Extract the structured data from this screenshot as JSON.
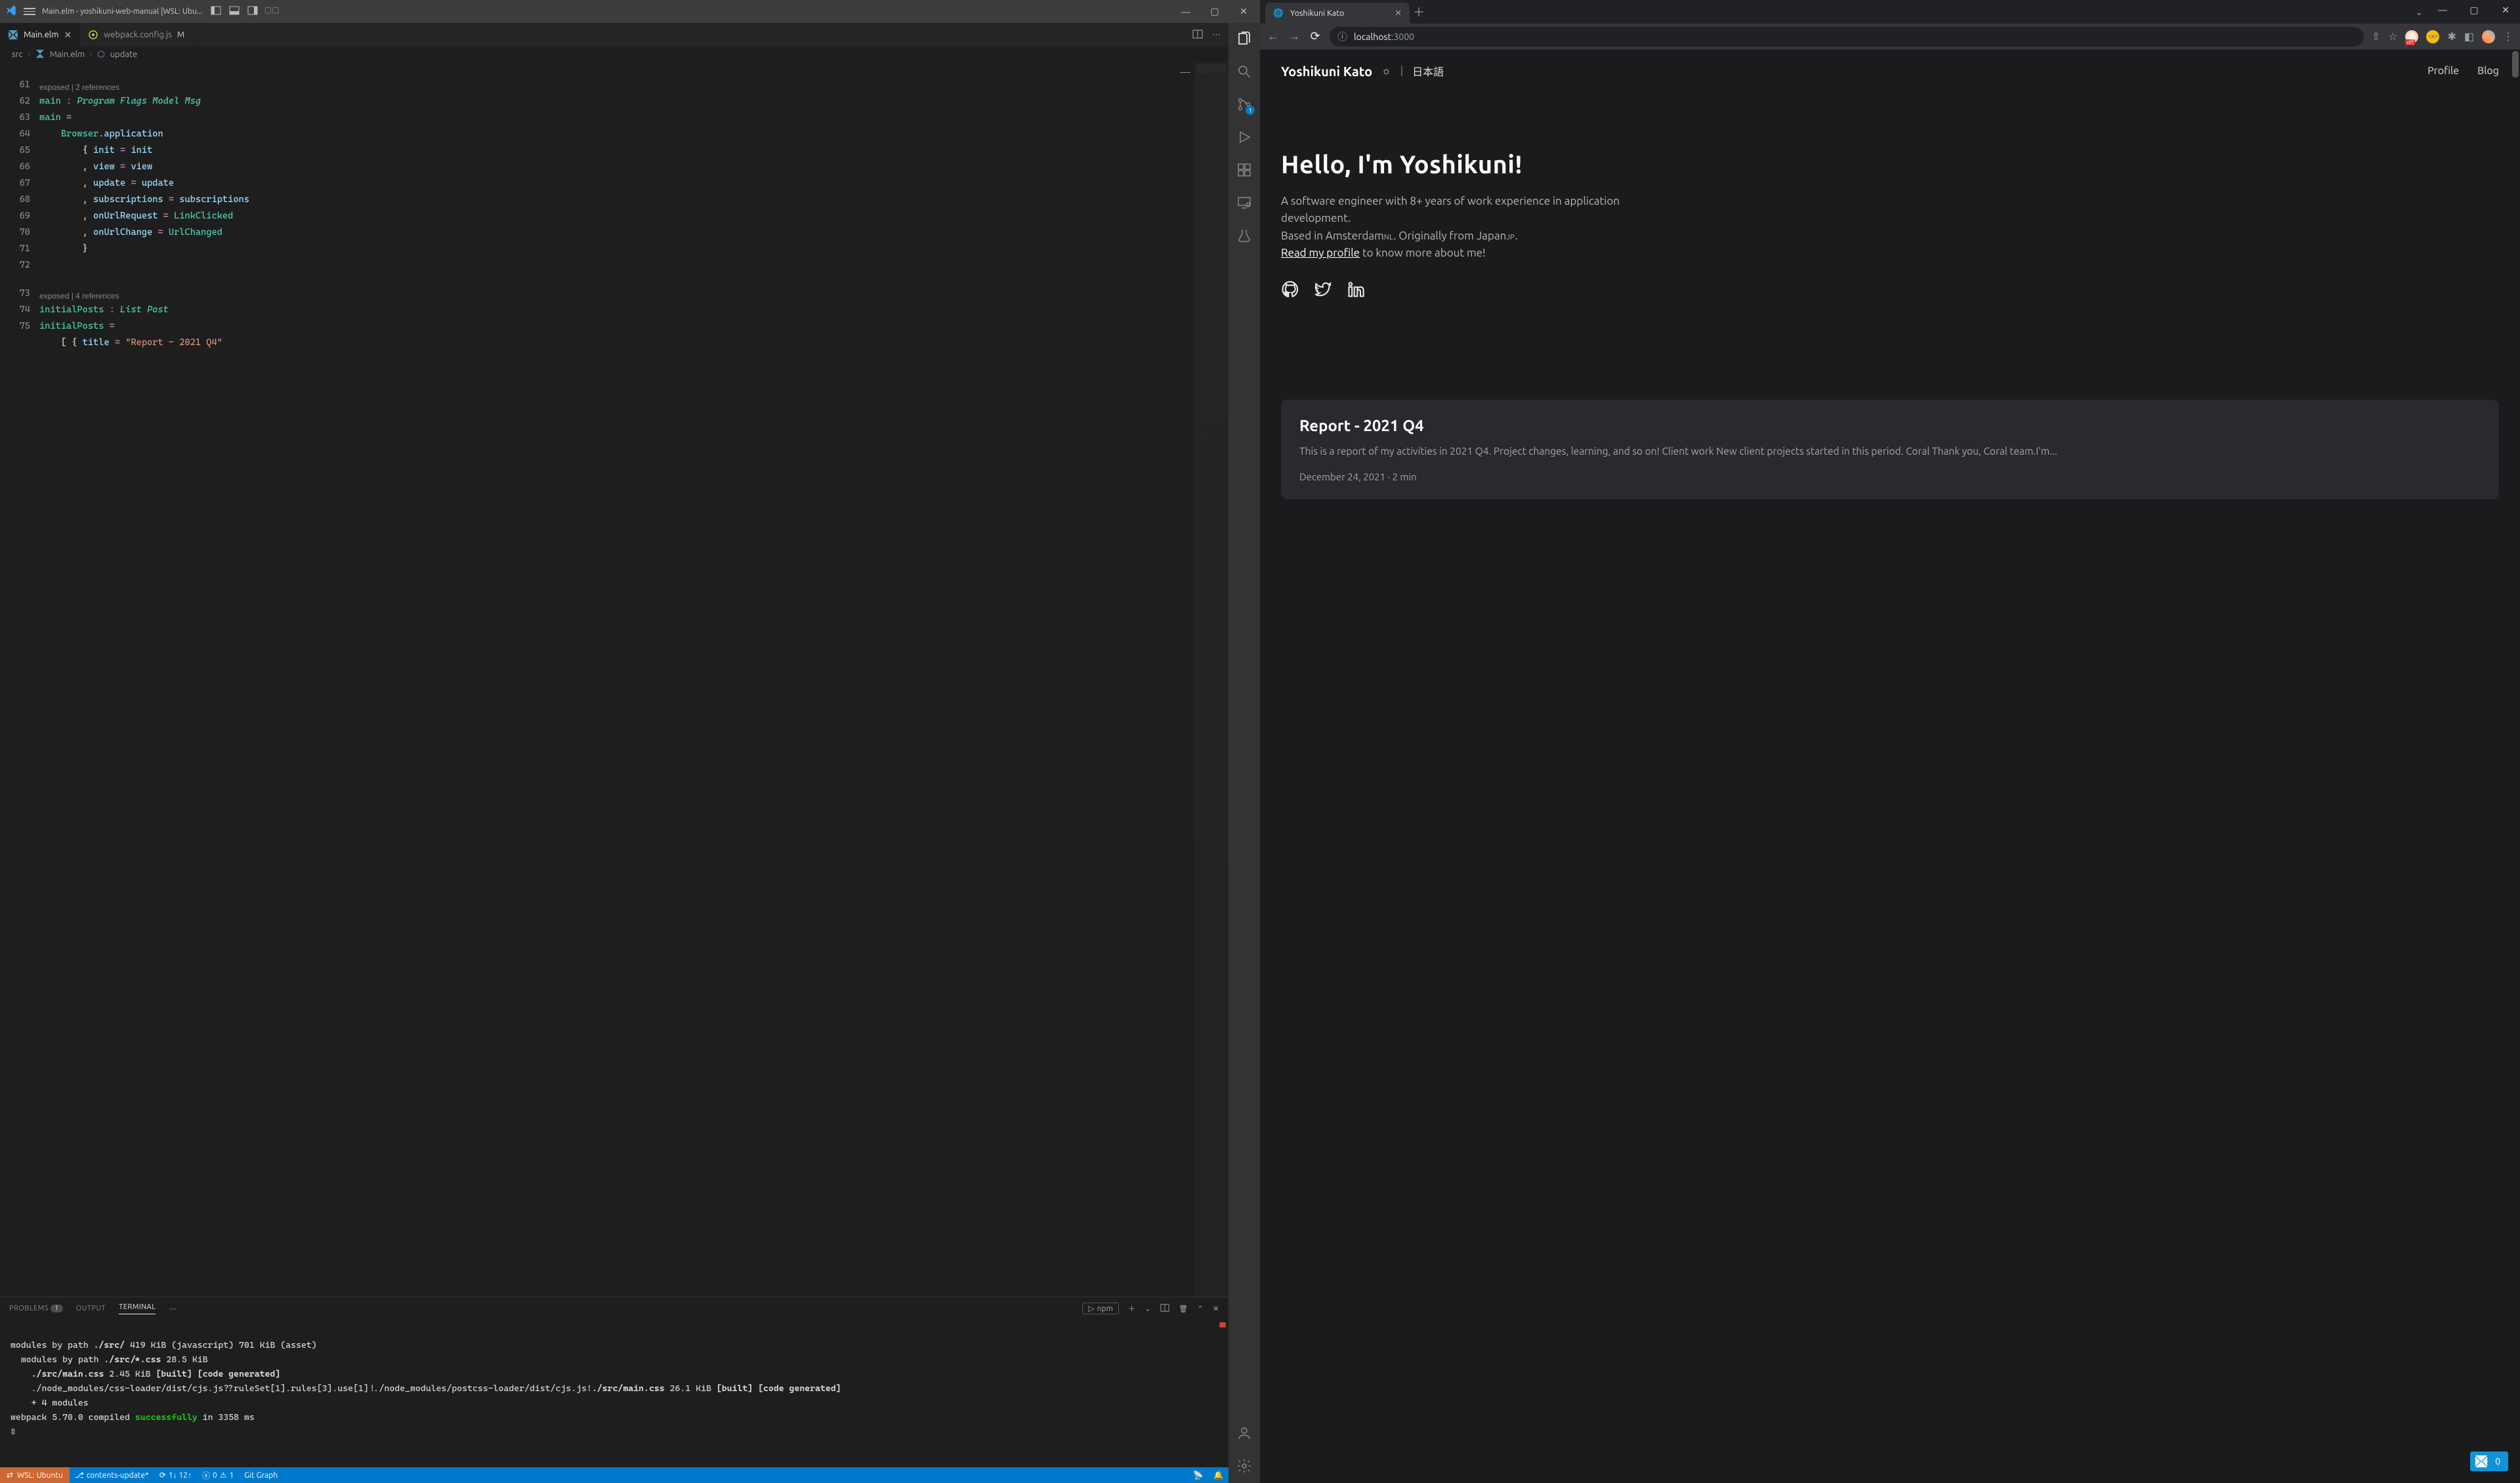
{
  "vscode": {
    "titlebar": {
      "title": "Main.elm - yoshikuni-web-manual [WSL: Ubu..."
    },
    "activitybar": {
      "scm_badge": "1"
    },
    "tabs": [
      {
        "label": "Main.elm",
        "icon_color": "#519aba",
        "active": true,
        "dirty": false
      },
      {
        "label": "webpack.config.js",
        "icon_color": "#cbcb41",
        "active": false,
        "dirty": true,
        "suffix": "M"
      }
    ],
    "breadcrumb": {
      "p1": "src",
      "p2": "Main.elm",
      "p3": "update"
    },
    "codelens1": "exposed | 2 references",
    "codelens2": "exposed | 4 references",
    "lines": {
      "n61": "61",
      "n62": "62",
      "n63": "63",
      "n64": "64",
      "n65": "65",
      "n66": "66",
      "n67": "67",
      "n68": "68",
      "n69": "69",
      "n70": "70",
      "n71": "71",
      "n72": "72",
      "n73": "73",
      "n74": "74",
      "n75": "75"
    },
    "code": {
      "l61_main": "main",
      "l61_colon": " : ",
      "l61_Program": "Program",
      "l61_sp": " ",
      "l61_Flags": "Flags",
      "l61_Model": "Model",
      "l61_Msg": "Msg",
      "l62_main": "main",
      "l62_eq": " =",
      "l63_Browser": "Browser",
      "l63_dot": ".",
      "l63_app": "application",
      "l64_brace": "{ ",
      "l64_k": "init",
      "l64_eq": " = ",
      "l64_v": "init",
      "l65_comma": ", ",
      "l65_k": "view",
      "l65_eq": " = ",
      "l65_v": "view",
      "l66_comma": ", ",
      "l66_k": "update",
      "l66_eq": " = ",
      "l66_v": "update",
      "l67_comma": ", ",
      "l67_k": "subscriptions",
      "l67_eq": " = ",
      "l67_v": "subscriptions",
      "l68_comma": ", ",
      "l68_k": "onUrlRequest",
      "l68_eq": " = ",
      "l68_v": "LinkClicked",
      "l69_comma": ", ",
      "l69_k": "onUrlChange",
      "l69_eq": " = ",
      "l69_v": "UrlChanged",
      "l70_brace": "}",
      "l73_name": "initialPosts",
      "l73_colon": " : ",
      "l73_List": "List",
      "l73_sp": " ",
      "l73_Post": "Post",
      "l74_name": "initialPosts",
      "l74_eq": " =",
      "l75_open": "[ { ",
      "l75_k": "title",
      "l75_eq": " = ",
      "l75_str": "\"Report - 2021 Q4\""
    },
    "panel": {
      "tabs": {
        "problems": "PROBLEMS",
        "problems_count": "1",
        "output": "OUTPUT",
        "terminal": "TERMINAL"
      },
      "task": "npm",
      "terminal_lines": [
        "modules by path ./src/ 419 KiB (javascript) 701 KiB (asset)",
        "  modules by path ./src/*.css 28.5 KiB",
        "    ./src/main.css 2.45 KiB [built] [code generated]",
        "    ./node_modules/css-loader/dist/cjs.js??ruleSet[1].rules[3].use[1]!./node_modules/postcss-loader/dist/cjs.js!./src/main.css 26.1 KiB [built] [code generated]",
        "    + 4 modules",
        "webpack 5.70.0 compiled successfully in 3358 ms"
      ],
      "prompt": "▯"
    },
    "status": {
      "wsl": "WSL: Ubuntu",
      "branch": "contents-update*",
      "sync": "1↓ 12↑",
      "errors": "0",
      "warnings": "1",
      "gitgraph": "Git Graph"
    }
  },
  "chrome": {
    "tab_title": "Yoshikuni Kato",
    "address_host": "localhost",
    "address_port": ":3000",
    "page": {
      "brand": "Yoshikuni Kato",
      "lang": "日本語",
      "nav_profile": "Profile",
      "nav_blog": "Blog",
      "hero_h1": "Hello, I'm Yoshikuni!",
      "hero_p1a": "A software engineer with 8+ years of work experience in application development.",
      "hero_p2a": "Based in Amsterdam",
      "hero_p2a_cc": "NL",
      "hero_p2b": ". Originally from Japan",
      "hero_p2b_cc": "JP",
      "hero_p2c": ".",
      "hero_p3_link": "Read my profile",
      "hero_p3_rest": " to know more about me!",
      "card_title": "Report - 2021 Q4",
      "card_body": "This is a report of my activities in 2021 Q4. Project changes, learning, and so on! Client work New client projects started in this period. Coral Thank you, Coral team.I'm...",
      "card_meta": "December 24, 2021 · 2 min",
      "elm_badge": "0"
    }
  }
}
